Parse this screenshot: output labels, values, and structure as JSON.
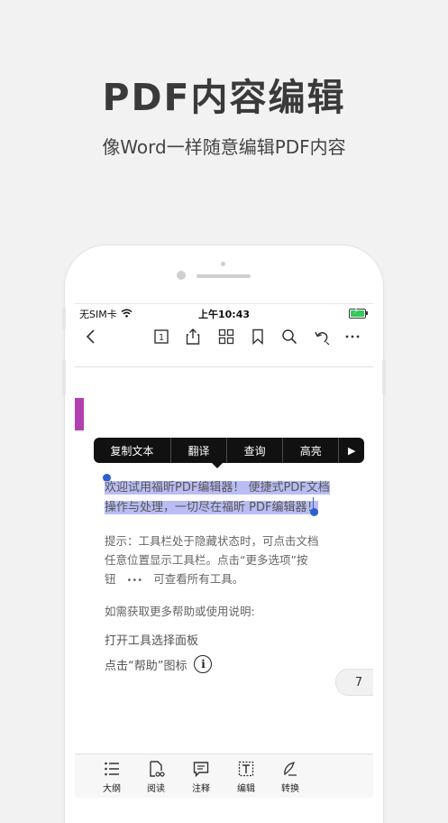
{
  "hero": {
    "title": "PDF内容编辑",
    "subtitle": "像Word一样随意编辑PDF内容"
  },
  "status_bar": {
    "carrier": "无SIM卡",
    "time": "上午10:43",
    "battery_color": "#34c759"
  },
  "toolbar": {
    "page_number": "1",
    "icons": [
      "back-icon",
      "page-number-icon",
      "share-icon",
      "thumbnails-icon",
      "bookmark-icon",
      "search-icon",
      "undo-icon",
      "more-icon"
    ]
  },
  "context_menu": {
    "items": [
      "复制文本",
      "翻译",
      "查询",
      "高亮"
    ],
    "more_arrow": "▶"
  },
  "document": {
    "selected_line1": "欢迎试用福昕PDF编辑器！ 便捷式PDF文档",
    "selected_line2": "操作与处理，一切尽在福昕 PDF编辑器！",
    "tip_line1": "提示：工具栏处于隐藏状态时，可点击文档",
    "tip_line2": "任意位置显示工具栏。点击“更多选项”按",
    "tip_line3_before": "钮",
    "tip_dots": "•••",
    "tip_line3_after": "可查看所有工具。",
    "help_heading": "如需获取更多帮助或使用说明:",
    "open_tools": "打开工具选择面板",
    "click_help": "点击“帮助”图标",
    "info_glyph": "i",
    "page_indicator": "7",
    "bookmark_color": "#b23fb0",
    "selection_color": "#b9bdf3"
  },
  "bottom_bar": {
    "items": [
      "大纲",
      "阅读",
      "注释",
      "编辑",
      "转换"
    ]
  }
}
